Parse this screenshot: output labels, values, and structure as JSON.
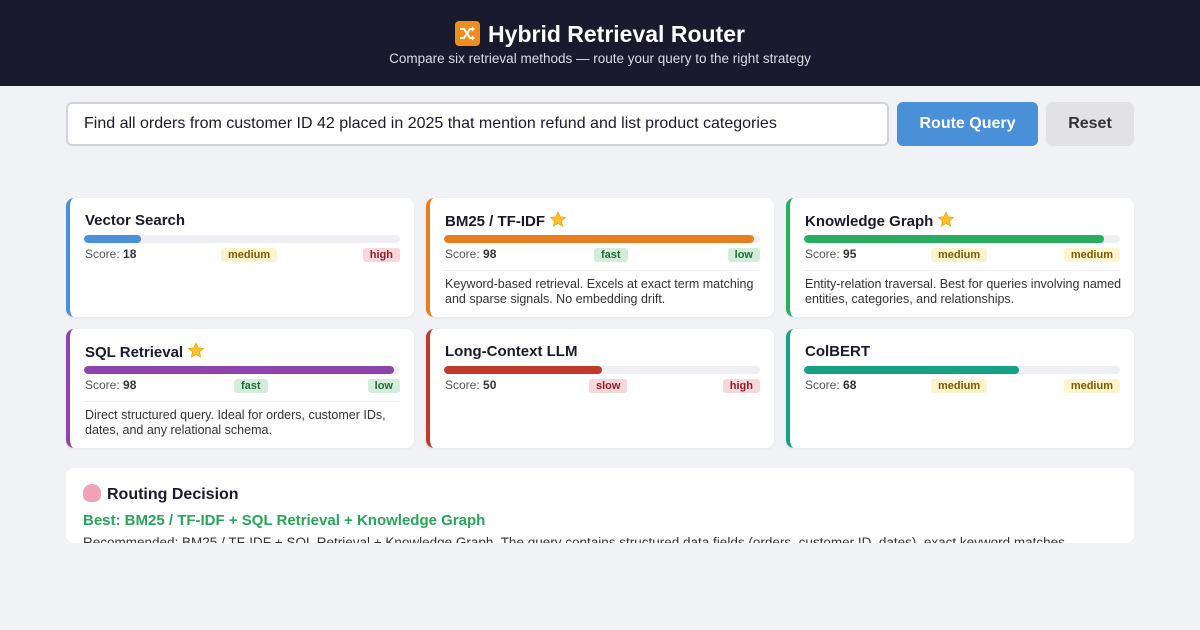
{
  "header": {
    "title": "Hybrid Retrieval Router",
    "subtitle": "Compare six retrieval methods — route your query to the right strategy",
    "logo_icon": "shuffle-icon"
  },
  "query": {
    "value": "Find all orders from customer ID 42 placed in 2025 that mention refund and list product categories",
    "route_label": "Route Query",
    "reset_label": "Reset"
  },
  "score_label": "Score:",
  "methods": [
    {
      "name": "Vector Search",
      "score": "18",
      "speed": "medium",
      "cost": "high",
      "starred": false,
      "color": "#4a90d9",
      "description": ""
    },
    {
      "name": "BM25 / TF-IDF",
      "score": "98",
      "speed": "fast",
      "cost": "low",
      "starred": true,
      "color": "#e67e22",
      "description": "Keyword-based retrieval. Excels at exact term matching and sparse signals. No embedding drift."
    },
    {
      "name": "Knowledge Graph",
      "score": "95",
      "speed": "medium",
      "cost": "medium",
      "starred": true,
      "color": "#27ae60",
      "description": "Entity-relation traversal. Best for queries involving named entities, categories, and relationships."
    },
    {
      "name": "SQL Retrieval",
      "score": "98",
      "speed": "fast",
      "cost": "low",
      "starred": true,
      "color": "#8e44ad",
      "description": "Direct structured query. Ideal for orders, customer IDs, dates, and any relational schema."
    },
    {
      "name": "Long-Context LLM",
      "score": "50",
      "speed": "slow",
      "cost": "high",
      "starred": false,
      "color": "#c0392b",
      "description": ""
    },
    {
      "name": "ColBERT",
      "score": "68",
      "speed": "medium",
      "cost": "medium",
      "starred": false,
      "color": "#16a085",
      "description": ""
    }
  ],
  "routing": {
    "heading": "Routing Decision",
    "icon": "brain-icon",
    "best": "Best: BM25 / TF-IDF + SQL Retrieval + Knowledge Graph",
    "reason": "Recommended: BM25 / TF-IDF + SQL Retrieval + Knowledge Graph. The query contains structured data fields (orders, customer ID, dates), exact keyword matches"
  }
}
